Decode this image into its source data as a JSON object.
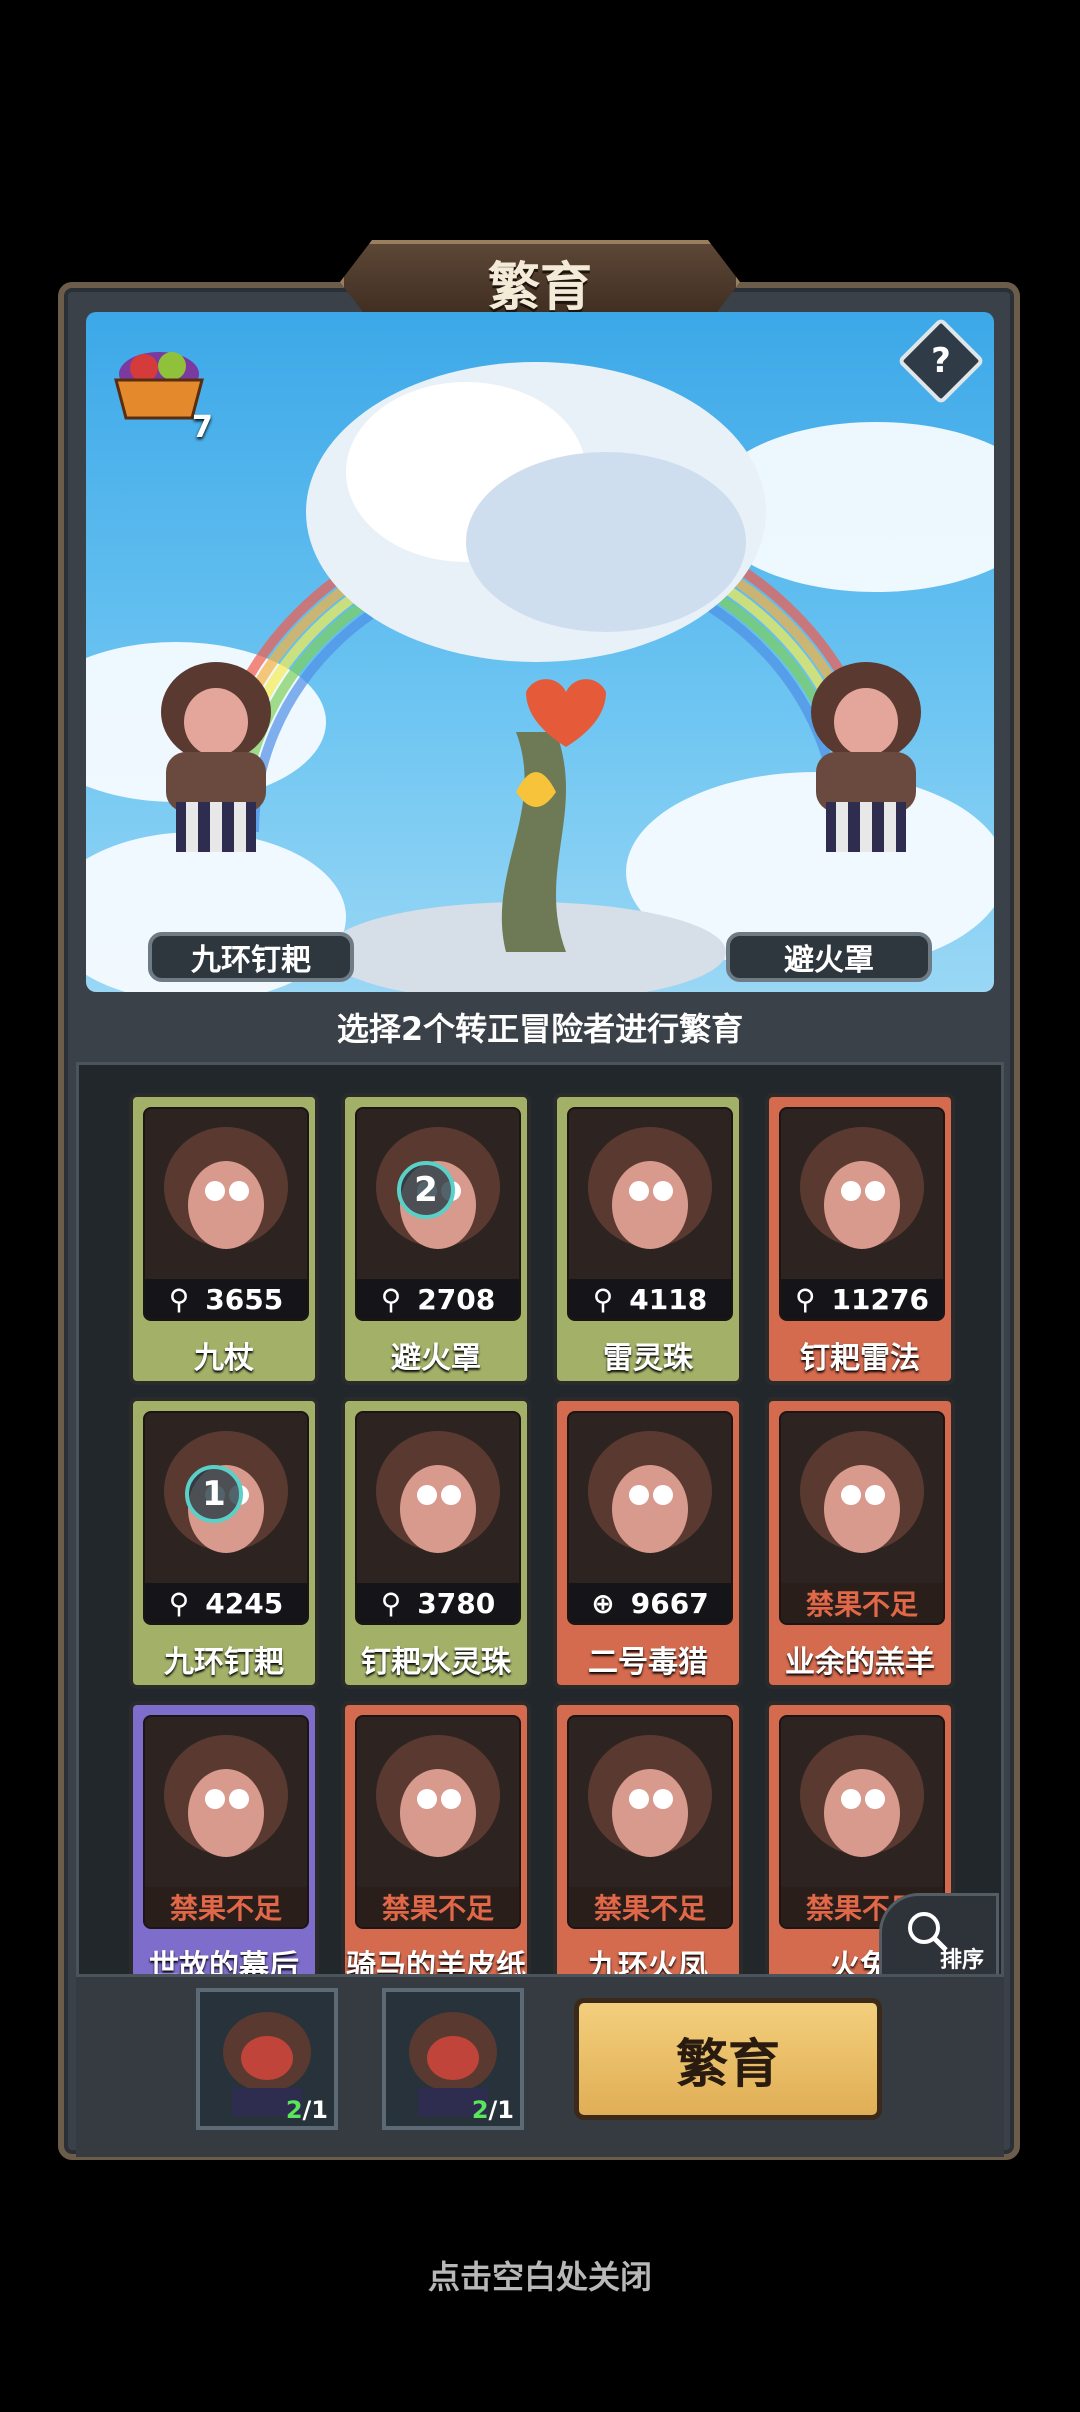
{
  "title": "繁育",
  "scene": {
    "fruit_count": "7",
    "help_label": "?",
    "left_name": "九环钉耙",
    "right_name": "避火罩"
  },
  "instruction": "选择2个转正冒险者进行繁育",
  "cards": [
    {
      "name": "九杖",
      "stat": "3655",
      "icon": "power-icon",
      "color": "green",
      "badge": ""
    },
    {
      "name": "避火罩",
      "stat": "2708",
      "icon": "power-icon",
      "color": "green",
      "badge": "2"
    },
    {
      "name": "雷灵珠",
      "stat": "4118",
      "icon": "power-icon",
      "color": "green",
      "badge": ""
    },
    {
      "name": "钉耙雷法",
      "stat": "11276",
      "icon": "power-icon",
      "color": "red",
      "badge": ""
    },
    {
      "name": "九环钉耙",
      "stat": "4245",
      "icon": "power-icon",
      "color": "green",
      "badge": "1"
    },
    {
      "name": "钉耙水灵珠",
      "stat": "3780",
      "icon": "power-icon",
      "color": "green",
      "badge": ""
    },
    {
      "name": "二号毒猎",
      "stat": "9667",
      "icon": "target-icon",
      "color": "red",
      "badge": ""
    },
    {
      "name": "业余的羔羊",
      "stat": "禁果不足",
      "icon": "",
      "color": "red",
      "badge": ""
    },
    {
      "name": "世故的幕后",
      "stat": "禁果不足",
      "icon": "",
      "color": "purple",
      "badge": ""
    },
    {
      "name": "骑马的羊皮纸",
      "stat": "禁果不足",
      "icon": "",
      "color": "red",
      "badge": ""
    },
    {
      "name": "九环火凤",
      "stat": "禁果不足",
      "icon": "",
      "color": "red",
      "badge": ""
    },
    {
      "name": "火免",
      "stat": "禁果不足",
      "icon": "",
      "color": "red",
      "badge": ""
    }
  ],
  "sort_label": "排序",
  "slots": [
    {
      "count_a": "2",
      "count_b": "/1"
    },
    {
      "count_a": "2",
      "count_b": "/1"
    }
  ],
  "breed_button": "繁育",
  "close_hint": "点击空白处关闭"
}
